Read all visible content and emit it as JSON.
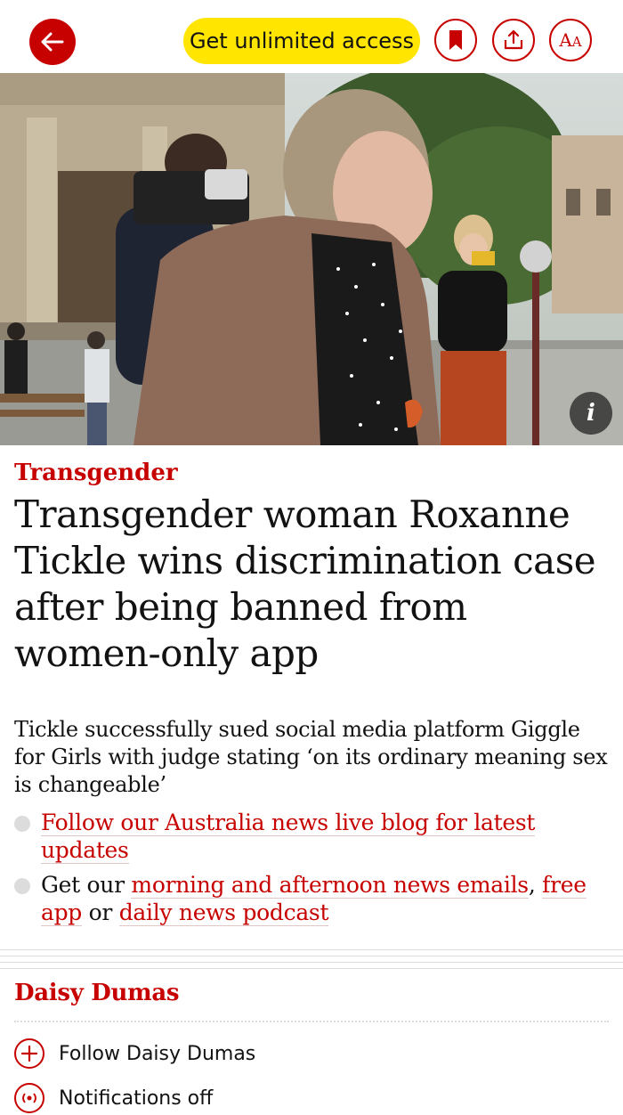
{
  "toolbar": {
    "cta_label": "Get unlimited access",
    "back_icon": "arrow-left-icon",
    "bookmark_icon": "bookmark-icon",
    "share_icon": "share-icon",
    "text_size_icon": "text-size-icon",
    "text_size_glyph": "AA",
    "accent": "#c70000",
    "cta_color": "#ffe500"
  },
  "hero": {
    "info_glyph": "i"
  },
  "article": {
    "kicker": "Transgender",
    "headline": "Transgender woman Roxanne Tickle wins discrimination case after being banned from women-only app",
    "standfirst": "Tickle successfully sued social media platform Giggle for Girls with judge stating ‘on its ordinary meaning sex is changeable’",
    "bullet1_link": "Follow our Australia news live blog for latest updates",
    "bullet2_prefix": "Get our ",
    "bullet2_link1": "morning and afternoon news emails",
    "bullet2_sep": ", ",
    "bullet2_link2": "free app",
    "bullet2_mid": " or ",
    "bullet2_link3": "daily news podcast"
  },
  "author": {
    "name": "Daisy Dumas",
    "follow_label": "Follow Daisy Dumas",
    "notifications_label": "Notifications off"
  }
}
